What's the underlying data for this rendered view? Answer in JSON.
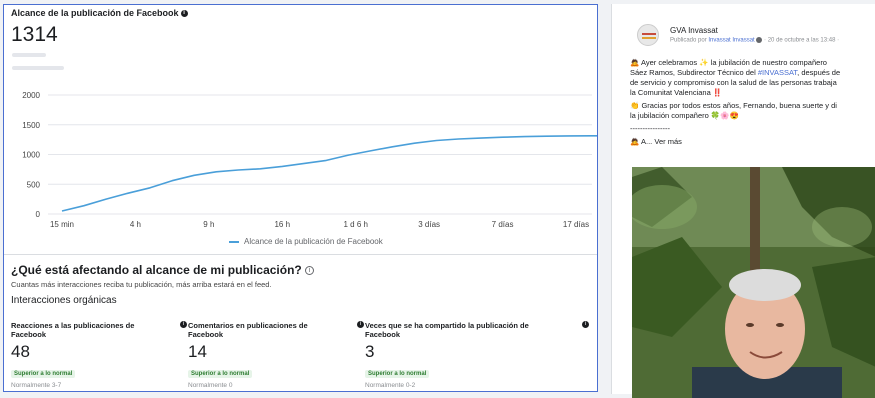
{
  "insights": {
    "chart_title": "Alcance de la publicación de Facebook",
    "total_reach": "1314",
    "legend_label": "Alcance de la publicación de Facebook"
  },
  "chart_data": {
    "type": "line",
    "title": "Alcance de la publicación de Facebook",
    "xlabel": "",
    "ylabel": "",
    "ylim": [
      0,
      2000
    ],
    "y_ticks": [
      "0",
      "500",
      "1000",
      "1500",
      "2000"
    ],
    "x_ticks": [
      "15 min",
      "4 h",
      "9 h",
      "16 h",
      "1 d 6 h",
      "3 días",
      "7 días",
      "17 días"
    ],
    "series": [
      {
        "name": "Alcance de la publicación de Facebook",
        "color": "#4a9fd9",
        "x_index": [
          0,
          0.3,
          0.6,
          0.9,
          1.2,
          1.5,
          1.8,
          2.1,
          2.4,
          2.7,
          3.0,
          3.3,
          3.6,
          3.9,
          4.2,
          4.5,
          4.8,
          5.1,
          5.4,
          5.7,
          6.0,
          6.3,
          6.6,
          6.9,
          7.2,
          7.5
        ],
        "values": [
          50,
          140,
          250,
          350,
          440,
          560,
          650,
          710,
          740,
          760,
          800,
          850,
          900,
          990,
          1060,
          1130,
          1190,
          1235,
          1260,
          1275,
          1290,
          1300,
          1308,
          1312,
          1314,
          1314
        ]
      }
    ]
  },
  "factors": {
    "title": "¿Qué está afectando al alcance de mi publicación?",
    "subtitle": "Cuantas más interacciones reciba tu publicación, más arriba estará en el feed.",
    "organic_title": "Interacciones orgánicas",
    "metrics": [
      {
        "label": "Reacciones a las publicaciones de Facebook",
        "value": "48",
        "badge": "Superior a lo normal",
        "normal": "Normalmente 3-7"
      },
      {
        "label": "Comentarios en publicaciones de Facebook",
        "value": "14",
        "badge": "Superior a lo normal",
        "normal": "Normalmente 0"
      },
      {
        "label": "Veces que se ha compartido la publicación de Facebook",
        "value": "3",
        "badge": "Superior a lo normal",
        "normal": "Normalmente 0-2"
      }
    ]
  },
  "post": {
    "page_name": "GVA Invassat",
    "meta_prefix": "Publicado por ",
    "meta_author": "Invassat Invassat",
    "meta_suffix": " · 20 de octubre a las 13:48 ·",
    "line1": "Ayer celebramos ✨ la jubilación de nuestro compañero",
    "line2_a": "Sáez Ramos, Subdirector Técnico del ",
    "hashtag": "#INVASSAT",
    "line2_b": ", después de",
    "line3": "de servicio y compromiso con la salud de las personas trabaja",
    "line4": "la Comunitat Valenciana ‼️",
    "line5": "Gracias por todos estos años, Fernando, buena suerte y di",
    "line6": "la jubilación compañero 🍀🌸😍",
    "separator": "----------------",
    "see_more": "A... Ver más"
  }
}
